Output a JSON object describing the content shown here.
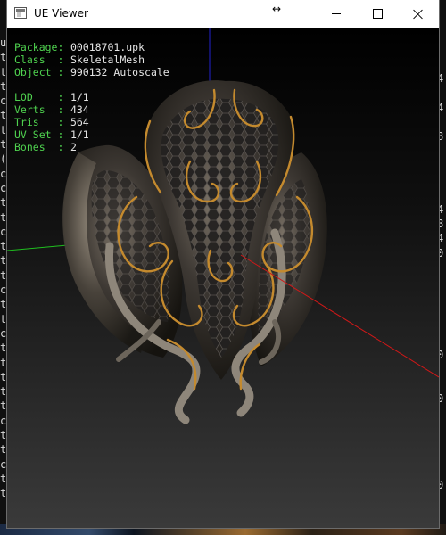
{
  "window": {
    "title": "UE Viewer",
    "resize_glyph": "↔"
  },
  "info": {
    "package_label": "Package:",
    "package_value": "00018701.upk",
    "class_label": "Class  :",
    "class_value": "SkeletalMesh",
    "object_label": "Object :",
    "object_value": "990132_Autoscale",
    "lod_label": "LOD    :",
    "lod_value": "1/1",
    "verts_label": "Verts  :",
    "verts_value": "434",
    "tris_label": "Tris   :",
    "tris_value": "564",
    "uvset_label": "UV Set :",
    "uvset_value": "1/1",
    "bones_label": "Bones  :",
    "bones_value": "2"
  },
  "background_console": {
    "left_chars": "u\nt\nt\nt\nc\nt\nt\nt\n(\nc\nc\nt\nt\nc\nt\nt\nt\nc\nt\nt\nc\nt\nt\nt\nt\nt\nc\nt\nt\nc\nt\nt",
    "right_chars": "4\n\n4\n\n8\n\n\n\n\n4\n8\n4\n0\n\n\n\n\n\n\n0\n\n\n0\n\n\n\n\n\n0\n\n\n\n0\n\n\n"
  },
  "colors": {
    "info_label": "#4fd24f",
    "info_value": "#e6e6e6",
    "axis_x": "#d01818",
    "axis_y": "#1fbf1f",
    "axis_z": "#2222d0"
  }
}
